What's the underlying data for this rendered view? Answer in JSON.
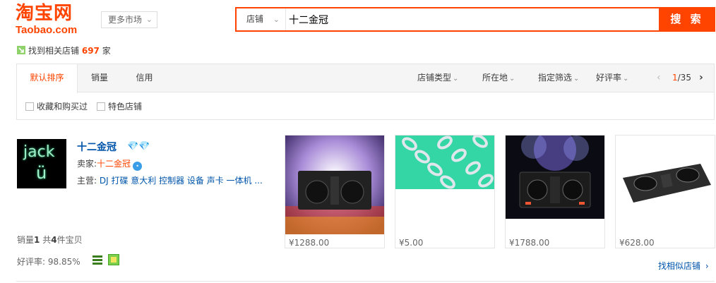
{
  "header": {
    "logo_cn": "淘宝网",
    "logo_en": "Taobao.com",
    "more_market": "更多市场",
    "search_scope": "店铺",
    "search_query": "十二金冠",
    "search_button": "搜 索"
  },
  "result_summary": {
    "prefix": "找到相关店铺",
    "count": "697",
    "suffix": "家"
  },
  "sort_tabs": [
    {
      "label": "默认排序",
      "active": true
    },
    {
      "label": "销量",
      "active": false
    },
    {
      "label": "信用",
      "active": false
    }
  ],
  "filters": [
    "店铺类型",
    "所在地",
    "指定筛选",
    "好评率"
  ],
  "pager": {
    "current": "1",
    "total": "/35"
  },
  "checkboxes": [
    "收藏和购买过",
    "特色店铺"
  ],
  "shop": {
    "avatar_line1": "jack",
    "avatar_line2": "ü",
    "name": "十二金冠",
    "seller_label": "卖家:",
    "seller_nick": "十二金冠",
    "main_label": "主营:",
    "main_items": "DJ 打碟 意大利 控制器 设备 声卡 一体机 ...",
    "sales_label": "销量",
    "sales_count": "1",
    "total_label_pre": "共",
    "total_count": "4",
    "total_label_post": "件宝贝",
    "rating_label": "好评率:",
    "rating_value": "98.85%"
  },
  "products": [
    {
      "price": "¥1288.00"
    },
    {
      "price": "¥5.00"
    },
    {
      "price": "¥1788.00"
    },
    {
      "price": "¥628.00"
    }
  ],
  "similar_link": "找相似店铺",
  "colors": {
    "brand": "#ff4400",
    "link": "#0055aa"
  }
}
